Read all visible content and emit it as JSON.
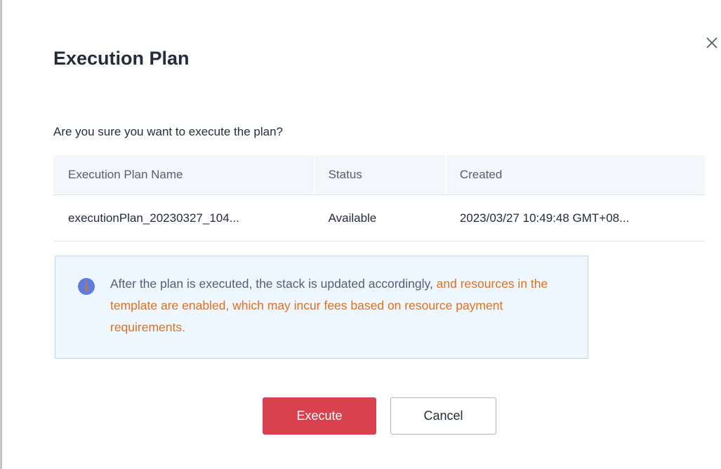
{
  "dialog": {
    "title": "Execution Plan",
    "question": "Are you sure you want to execute the plan?",
    "close_icon": "close-icon"
  },
  "table": {
    "headers": [
      "Execution Plan Name",
      "Status",
      "Created"
    ],
    "rows": [
      {
        "name": "executionPlan_20230327_104...",
        "status": "Available",
        "created": "2023/03/27 10:49:48 GMT+08..."
      }
    ]
  },
  "notice": {
    "icon": "info-icon",
    "text_normal": "After the plan is executed, the stack is updated accordingly, ",
    "text_warning": "and resources in the template are enabled, which may incur fees based on resource payment requirements.",
    "colors": {
      "info": "#5e7ce0",
      "warning": "#e0701c",
      "background": "#eef6ff",
      "border": "#b8d6f8"
    }
  },
  "buttons": {
    "execute_label": "Execute",
    "cancel_label": "Cancel",
    "execute_color": "#d9414f"
  }
}
